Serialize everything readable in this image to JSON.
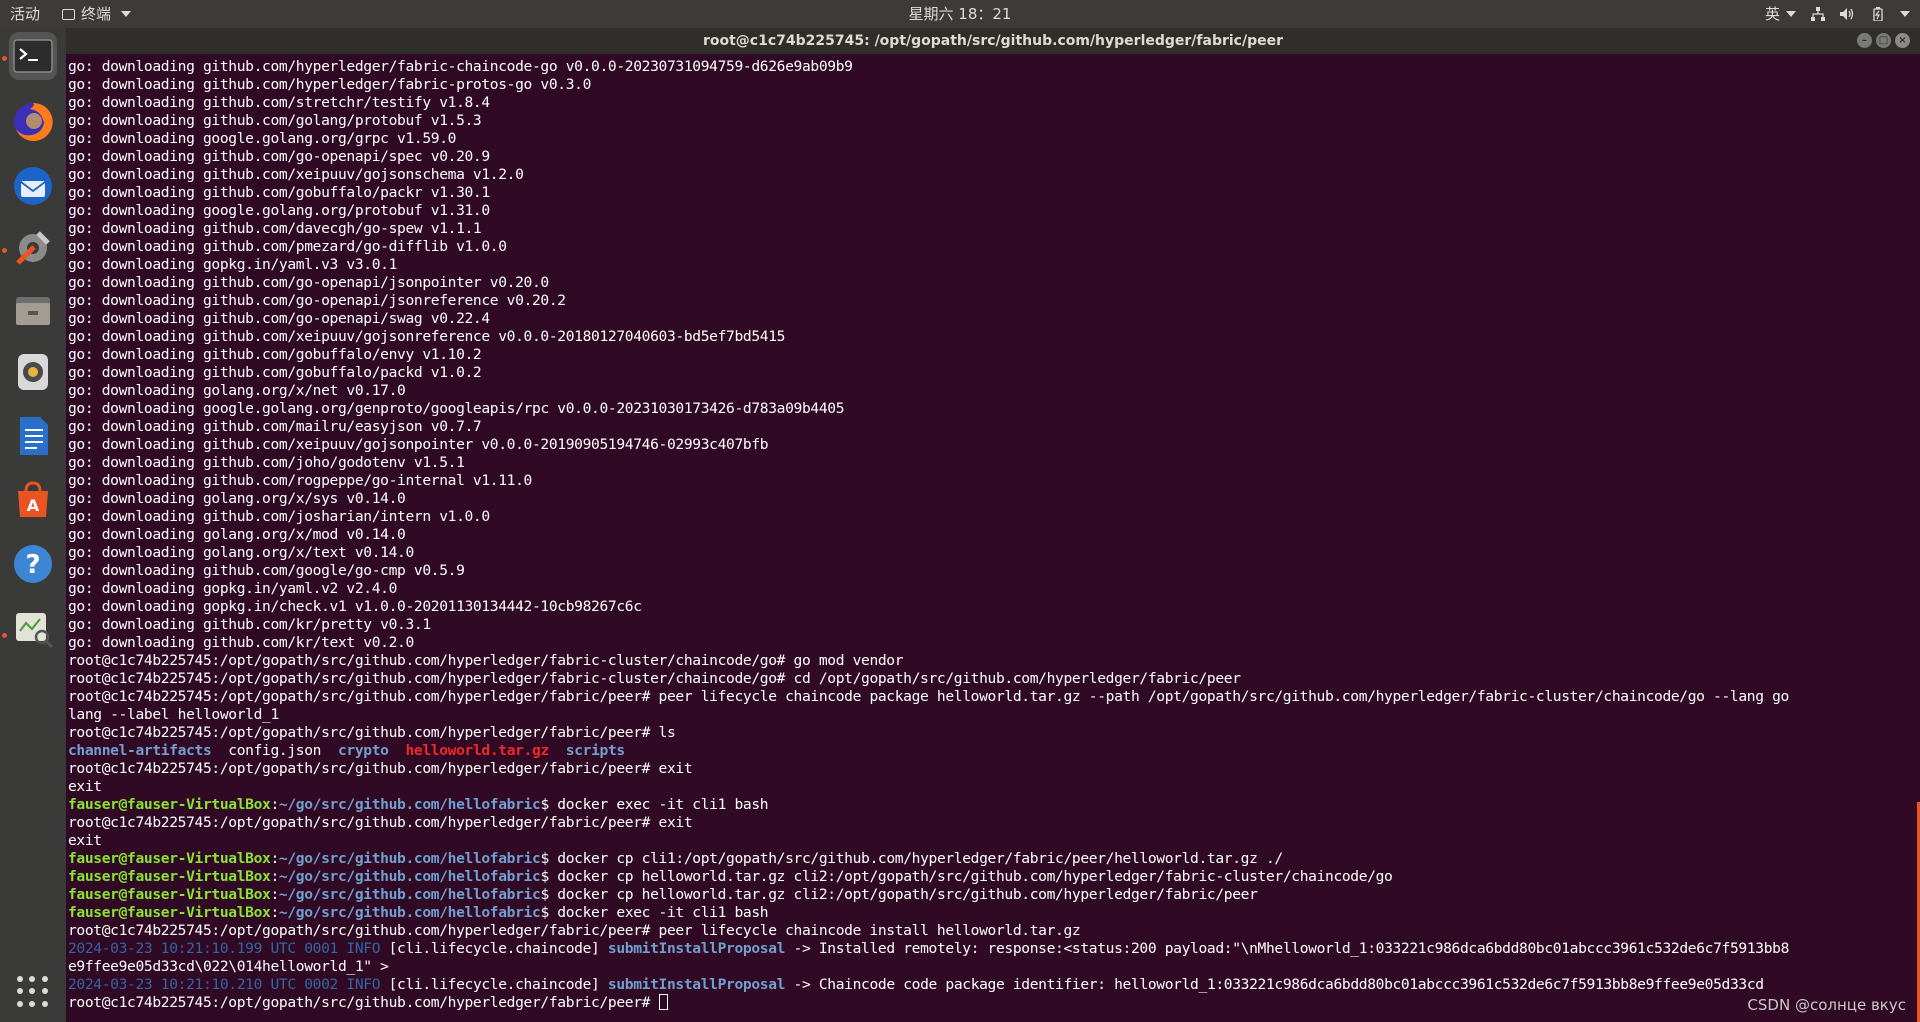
{
  "topbar": {
    "activities": "活动",
    "app_name": "终端",
    "clock": "星期六 18：21",
    "input_method": "英"
  },
  "window": {
    "title": "root@c1c74b225745: /opt/gopath/src/github.com/hyperledger/fabric/peer"
  },
  "dock": {
    "items": [
      "terminal-icon",
      "firefox-icon",
      "thunderbird-icon",
      "settings-icon",
      "files-icon",
      "rhythmbox-icon",
      "writer-icon",
      "software-center-icon",
      "help-icon",
      "system-monitor-icon"
    ],
    "apps_button": "show-applications-icon"
  },
  "colors": {
    "background": "#300a24",
    "prompt_user": "#8ae234",
    "prompt_path": "#729fcf",
    "archive": "#ef2929",
    "accent": "#e95420"
  },
  "terminal": {
    "lines": [
      [
        {
          "t": "go: downloading github.com/hyperledger/fabric-chaincode-go v0.0.0-20230731094759-d626e9ab09b9"
        }
      ],
      [
        {
          "t": "go: downloading github.com/hyperledger/fabric-protos-go v0.3.0"
        }
      ],
      [
        {
          "t": "go: downloading github.com/stretchr/testify v1.8.4"
        }
      ],
      [
        {
          "t": "go: downloading github.com/golang/protobuf v1.5.3"
        }
      ],
      [
        {
          "t": "go: downloading google.golang.org/grpc v1.59.0"
        }
      ],
      [
        {
          "t": "go: downloading github.com/go-openapi/spec v0.20.9"
        }
      ],
      [
        {
          "t": "go: downloading github.com/xeipuuv/gojsonschema v1.2.0"
        }
      ],
      [
        {
          "t": "go: downloading github.com/gobuffalo/packr v1.30.1"
        }
      ],
      [
        {
          "t": "go: downloading google.golang.org/protobuf v1.31.0"
        }
      ],
      [
        {
          "t": "go: downloading github.com/davecgh/go-spew v1.1.1"
        }
      ],
      [
        {
          "t": "go: downloading github.com/pmezard/go-difflib v1.0.0"
        }
      ],
      [
        {
          "t": "go: downloading gopkg.in/yaml.v3 v3.0.1"
        }
      ],
      [
        {
          "t": "go: downloading github.com/go-openapi/jsonpointer v0.20.0"
        }
      ],
      [
        {
          "t": "go: downloading github.com/go-openapi/jsonreference v0.20.2"
        }
      ],
      [
        {
          "t": "go: downloading github.com/go-openapi/swag v0.22.4"
        }
      ],
      [
        {
          "t": "go: downloading github.com/xeipuuv/gojsonreference v0.0.0-20180127040603-bd5ef7bd5415"
        }
      ],
      [
        {
          "t": "go: downloading github.com/gobuffalo/envy v1.10.2"
        }
      ],
      [
        {
          "t": "go: downloading github.com/gobuffalo/packd v1.0.2"
        }
      ],
      [
        {
          "t": "go: downloading golang.org/x/net v0.17.0"
        }
      ],
      [
        {
          "t": "go: downloading google.golang.org/genproto/googleapis/rpc v0.0.0-20231030173426-d783a09b4405"
        }
      ],
      [
        {
          "t": "go: downloading github.com/mailru/easyjson v0.7.7"
        }
      ],
      [
        {
          "t": "go: downloading github.com/xeipuuv/gojsonpointer v0.0.0-20190905194746-02993c407bfb"
        }
      ],
      [
        {
          "t": "go: downloading github.com/joho/godotenv v1.5.1"
        }
      ],
      [
        {
          "t": "go: downloading github.com/rogpeppe/go-internal v1.11.0"
        }
      ],
      [
        {
          "t": "go: downloading golang.org/x/sys v0.14.0"
        }
      ],
      [
        {
          "t": "go: downloading github.com/josharian/intern v1.0.0"
        }
      ],
      [
        {
          "t": "go: downloading golang.org/x/mod v0.14.0"
        }
      ],
      [
        {
          "t": "go: downloading golang.org/x/text v0.14.0"
        }
      ],
      [
        {
          "t": "go: downloading github.com/google/go-cmp v0.5.9"
        }
      ],
      [
        {
          "t": "go: downloading gopkg.in/yaml.v2 v2.4.0"
        }
      ],
      [
        {
          "t": "go: downloading gopkg.in/check.v1 v1.0.0-20201130134442-10cb98267c6c"
        }
      ],
      [
        {
          "t": "go: downloading github.com/kr/pretty v0.3.1"
        }
      ],
      [
        {
          "t": "go: downloading github.com/kr/text v0.2.0"
        }
      ],
      [
        {
          "t": "root@c1c74b225745:/opt/gopath/src/github.com/hyperledger/fabric-cluster/chaincode/go# go mod vendor"
        }
      ],
      [
        {
          "t": "root@c1c74b225745:/opt/gopath/src/github.com/hyperledger/fabric-cluster/chaincode/go# cd /opt/gopath/src/github.com/hyperledger/fabric/peer"
        }
      ],
      [
        {
          "t": "root@c1c74b225745:/opt/gopath/src/github.com/hyperledger/fabric/peer# peer lifecycle chaincode package helloworld.tar.gz --path /opt/gopath/src/github.com/hyperledger/fabric-cluster/chaincode/go --lang go"
        }
      ],
      [
        {
          "t": "lang --label helloworld_1"
        }
      ],
      [
        {
          "t": "root@c1c74b225745:/opt/gopath/src/github.com/hyperledger/fabric/peer# ls"
        }
      ],
      [
        {
          "t": "channel-artifacts",
          "c": "dir"
        },
        {
          "t": "  config.json  "
        },
        {
          "t": "crypto",
          "c": "dir"
        },
        {
          "t": "  "
        },
        {
          "t": "helloworld.tar.gz",
          "c": "archive"
        },
        {
          "t": "  "
        },
        {
          "t": "scripts",
          "c": "dir"
        }
      ],
      [
        {
          "t": "root@c1c74b225745:/opt/gopath/src/github.com/hyperledger/fabric/peer# exit"
        }
      ],
      [
        {
          "t": "exit"
        }
      ],
      [
        {
          "t": "fauser@fauser-VirtualBox",
          "c": "prompt-user"
        },
        {
          "t": ":"
        },
        {
          "t": "~/go/src/github.com/hellofabric",
          "c": "prompt-path"
        },
        {
          "t": "$ docker exec -it cli1 bash"
        }
      ],
      [
        {
          "t": "root@c1c74b225745:/opt/gopath/src/github.com/hyperledger/fabric/peer# exit"
        }
      ],
      [
        {
          "t": "exit"
        }
      ],
      [
        {
          "t": "fauser@fauser-VirtualBox",
          "c": "prompt-user"
        },
        {
          "t": ":"
        },
        {
          "t": "~/go/src/github.com/hellofabric",
          "c": "prompt-path"
        },
        {
          "t": "$ docker cp cli1:/opt/gopath/src/github.com/hyperledger/fabric/peer/helloworld.tar.gz ./"
        }
      ],
      [
        {
          "t": "fauser@fauser-VirtualBox",
          "c": "prompt-user"
        },
        {
          "t": ":"
        },
        {
          "t": "~/go/src/github.com/hellofabric",
          "c": "prompt-path"
        },
        {
          "t": "$ docker cp helloworld.tar.gz cli2:/opt/gopath/src/github.com/hyperledger/fabric-cluster/chaincode/go"
        }
      ],
      [
        {
          "t": "fauser@fauser-VirtualBox",
          "c": "prompt-user"
        },
        {
          "t": ":"
        },
        {
          "t": "~/go/src/github.com/hellofabric",
          "c": "prompt-path"
        },
        {
          "t": "$ docker cp helloworld.tar.gz cli2:/opt/gopath/src/github.com/hyperledger/fabric/peer"
        }
      ],
      [
        {
          "t": "fauser@fauser-VirtualBox",
          "c": "prompt-user"
        },
        {
          "t": ":"
        },
        {
          "t": "~/go/src/github.com/hellofabric",
          "c": "prompt-path"
        },
        {
          "t": "$ docker exec -it cli1 bash"
        }
      ],
      [
        {
          "t": "root@c1c74b225745:/opt/gopath/src/github.com/hyperledger/fabric/peer# peer lifecycle chaincode install helloworld.tar.gz"
        }
      ],
      [
        {
          "t": "2024-03-23 10:21:10.199 UTC 0001 INFO",
          "c": "dim"
        },
        {
          "t": " [cli.lifecycle.chaincode] "
        },
        {
          "t": "submitInstallProposal",
          "c": "func"
        },
        {
          "t": " -> Installed remotely: response:<status:200 payload:\"\\nMhelloworld_1:033221c986dca6bdd80bc01abccc3961c532de6c7f5913bb8"
        }
      ],
      [
        {
          "t": "e9ffee9e05d33cd\\022\\014helloworld_1\" >"
        }
      ],
      [
        {
          "t": "2024-03-23 10:21:10.210 UTC 0002 INFO",
          "c": "dim"
        },
        {
          "t": " [cli.lifecycle.chaincode] "
        },
        {
          "t": "submitInstallProposal",
          "c": "func"
        },
        {
          "t": " -> Chaincode code package identifier: helloworld_1:033221c986dca6bdd80bc01abccc3961c532de6c7f5913bb8e9ffee9e05d33cd"
        }
      ],
      [
        {
          "t": "root@c1c74b225745:/opt/gopath/src/github.com/hyperledger/fabric/peer# "
        }
      ]
    ]
  },
  "watermark": "CSDN @солнце вкус"
}
